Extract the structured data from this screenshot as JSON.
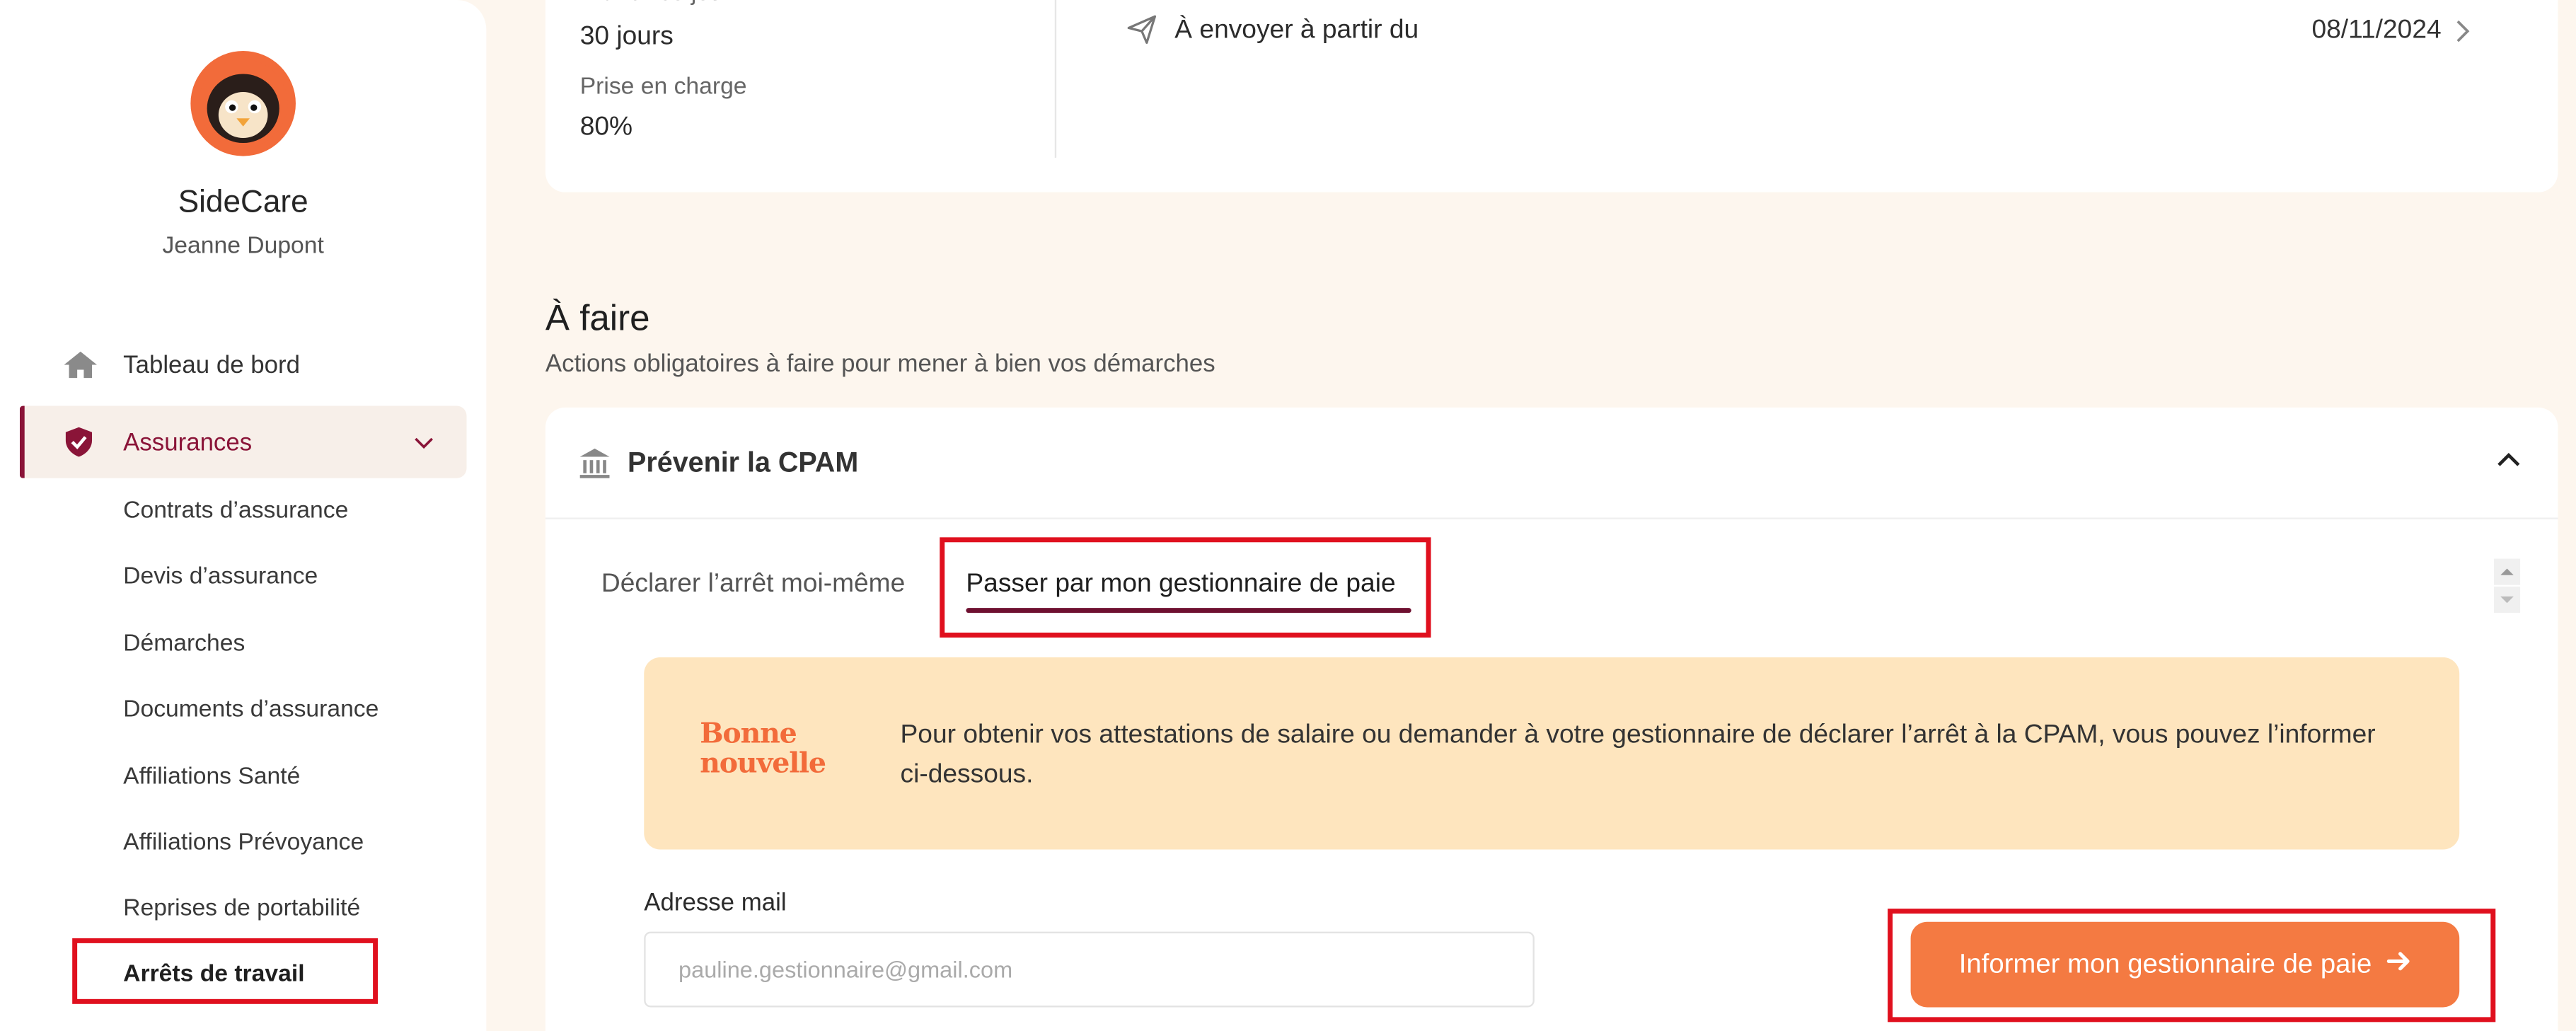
{
  "sidebar": {
    "brand": "SideCare",
    "user": "Jeanne Dupont",
    "nav": [
      {
        "label": "Tableau de bord",
        "icon": "home-icon"
      },
      {
        "label": "Assurances",
        "icon": "shield-check-icon",
        "active": true,
        "expanded": true
      }
    ],
    "sub_items": [
      "Contrats d’assurance",
      "Devis d’assurance",
      "Démarches",
      "Documents d’assurance",
      "Affiliations Santé",
      "Affiliations Prévoyance",
      "Reprises de portabilité",
      "Arrêts de travail"
    ],
    "current_sub": "Arrêts de travail"
  },
  "top_card": {
    "franchise_label": "Franchise jour",
    "franchise_value": "30 jours",
    "prise_label": "Prise en charge",
    "prise_value": "80%",
    "send_label": "À envoyer à partir du",
    "send_date": "08/11/2024"
  },
  "todo": {
    "title": "À faire",
    "subtitle": "Actions obligatoires à faire pour mener à bien vos démarches",
    "card_title": "Prévenir la CPAM",
    "tabs": [
      "Déclarer l’arrêt moi-même",
      "Passer par mon gestionnaire de paie"
    ],
    "active_tab": 1,
    "info_badge": "Bonne nouvelle",
    "info_text": "Pour obtenir vos attestations de salaire ou demander à votre gestionnaire de déclarer l’arrêt à la CPAM, vous pouvez l’informer ci-dessous.",
    "email_label": "Adresse mail",
    "email_placeholder": "pauline.gestionnaire@gmail.com",
    "button_label": "Informer mon gestionnaire de paie"
  },
  "colors": {
    "accent": "#f47a42",
    "brand_dark": "#8a1438",
    "info_bg": "#fee5be",
    "page_bg": "#fdf6ee",
    "highlight": "#e0101e"
  }
}
